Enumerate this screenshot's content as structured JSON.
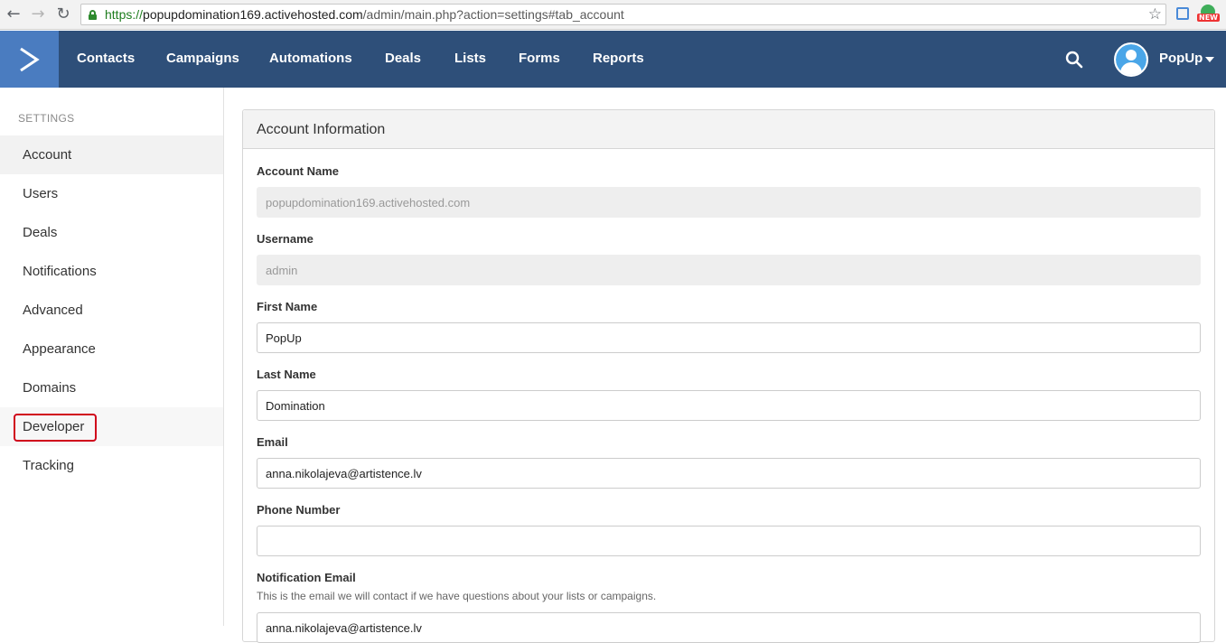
{
  "browser": {
    "url_secure": "https://",
    "url_host": "popupdomination169.activehosted.com",
    "url_path": "/admin/main.php?action=settings#tab_account",
    "ext_badge": "NEW"
  },
  "header": {
    "nav": [
      {
        "label": "Contacts"
      },
      {
        "label": "Campaigns"
      },
      {
        "label": "Automations"
      },
      {
        "label": "Deals"
      },
      {
        "label": "Lists"
      },
      {
        "label": "Forms"
      },
      {
        "label": "Reports"
      }
    ],
    "user_name": "PopUp"
  },
  "sidebar": {
    "heading": "SETTINGS",
    "items": [
      {
        "label": "Account",
        "state": "active"
      },
      {
        "label": "Users"
      },
      {
        "label": "Deals"
      },
      {
        "label": "Notifications"
      },
      {
        "label": "Advanced"
      },
      {
        "label": "Appearance"
      },
      {
        "label": "Domains"
      },
      {
        "label": "Developer",
        "state": "highlighted"
      },
      {
        "label": "Tracking"
      }
    ]
  },
  "panel": {
    "title": "Account Information",
    "fields": {
      "account_name": {
        "label": "Account Name",
        "value": "popupdomination169.activehosted.com"
      },
      "username": {
        "label": "Username",
        "value": "admin"
      },
      "first_name": {
        "label": "First Name",
        "value": "PopUp"
      },
      "last_name": {
        "label": "Last Name",
        "value": "Domination"
      },
      "email": {
        "label": "Email",
        "value": "anna.nikolajeva@artistence.lv"
      },
      "phone": {
        "label": "Phone Number",
        "value": ""
      },
      "notification_email": {
        "label": "Notification Email",
        "help": "This is the email we will contact if we have questions about your lists or campaigns.",
        "value": "anna.nikolajeva@artistence.lv"
      }
    }
  },
  "colors": {
    "header_bg": "#2e4f79",
    "logo_bg": "#4a7cc0",
    "highlight": "#d0021b"
  }
}
